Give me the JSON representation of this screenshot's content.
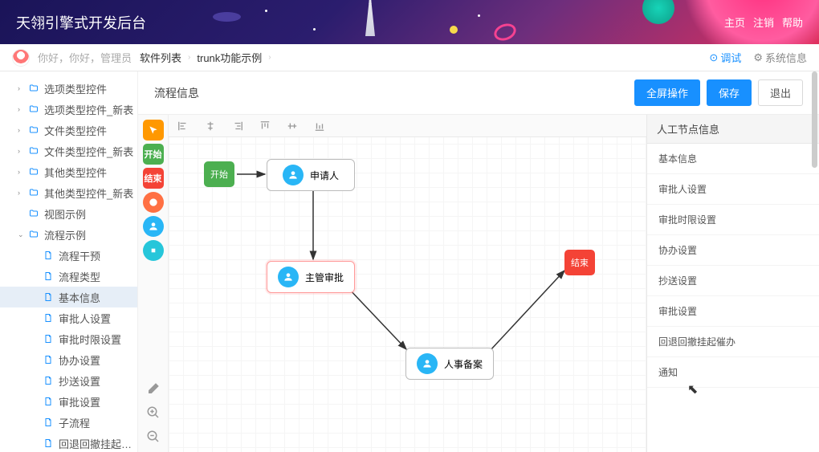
{
  "header": {
    "title": "天翎引擎式开发后台",
    "links": {
      "home": "主页",
      "logout": "注销",
      "help": "帮助"
    }
  },
  "subheader": {
    "greeting": "你好，你好，管理员",
    "breadcrumbs": [
      "软件列表",
      "trunk功能示例"
    ],
    "debug": "调试",
    "sysinfo": "系统信息"
  },
  "sidebar": {
    "items": [
      {
        "label": "选项类型控件",
        "type": "folder",
        "depth": 1,
        "caret": "›"
      },
      {
        "label": "选项类型控件_新表",
        "type": "folder",
        "depth": 1,
        "caret": "›"
      },
      {
        "label": "文件类型控件",
        "type": "folder",
        "depth": 1,
        "caret": "›"
      },
      {
        "label": "文件类型控件_新表",
        "type": "folder",
        "depth": 1,
        "caret": "›"
      },
      {
        "label": "其他类型控件",
        "type": "folder",
        "depth": 1,
        "caret": "›"
      },
      {
        "label": "其他类型控件_新表",
        "type": "folder",
        "depth": 1,
        "caret": "›"
      },
      {
        "label": "视图示例",
        "type": "folder",
        "depth": 1,
        "caret": ""
      },
      {
        "label": "流程示例",
        "type": "folder",
        "depth": 1,
        "caret": "⌄",
        "open": true
      },
      {
        "label": "流程干预",
        "type": "file",
        "depth": 2
      },
      {
        "label": "流程类型",
        "type": "file",
        "depth": 2
      },
      {
        "label": "基本信息",
        "type": "file",
        "depth": 2,
        "selected": true
      },
      {
        "label": "审批人设置",
        "type": "file",
        "depth": 2
      },
      {
        "label": "审批时限设置",
        "type": "file",
        "depth": 2
      },
      {
        "label": "协办设置",
        "type": "file",
        "depth": 2
      },
      {
        "label": "抄送设置",
        "type": "file",
        "depth": 2
      },
      {
        "label": "审批设置",
        "type": "file",
        "depth": 2
      },
      {
        "label": "子流程",
        "type": "file",
        "depth": 2
      },
      {
        "label": "回退回撤挂起催办",
        "type": "file",
        "depth": 2
      }
    ]
  },
  "content": {
    "title": "流程信息",
    "actions": {
      "fullscreen": "全屏操作",
      "save": "保存",
      "exit": "退出"
    }
  },
  "palette": {
    "start": "开始",
    "end": "结束"
  },
  "alignTools": [
    "align-left",
    "align-center-h",
    "align-right",
    "align-top",
    "align-middle",
    "align-bottom"
  ],
  "flow": {
    "startNode": "开始",
    "endNode": "结束",
    "applicant": "申请人",
    "supervisor": "主管审批",
    "hr": "人事备案"
  },
  "rightPanel": {
    "header": "人工节点信息",
    "items": [
      "基本信息",
      "审批人设置",
      "审批时限设置",
      "协办设置",
      "抄送设置",
      "审批设置",
      "回退回撤挂起催办",
      "通知"
    ]
  },
  "colors": {
    "primary": "#1890ff",
    "green": "#4caf50",
    "red": "#f44336"
  }
}
